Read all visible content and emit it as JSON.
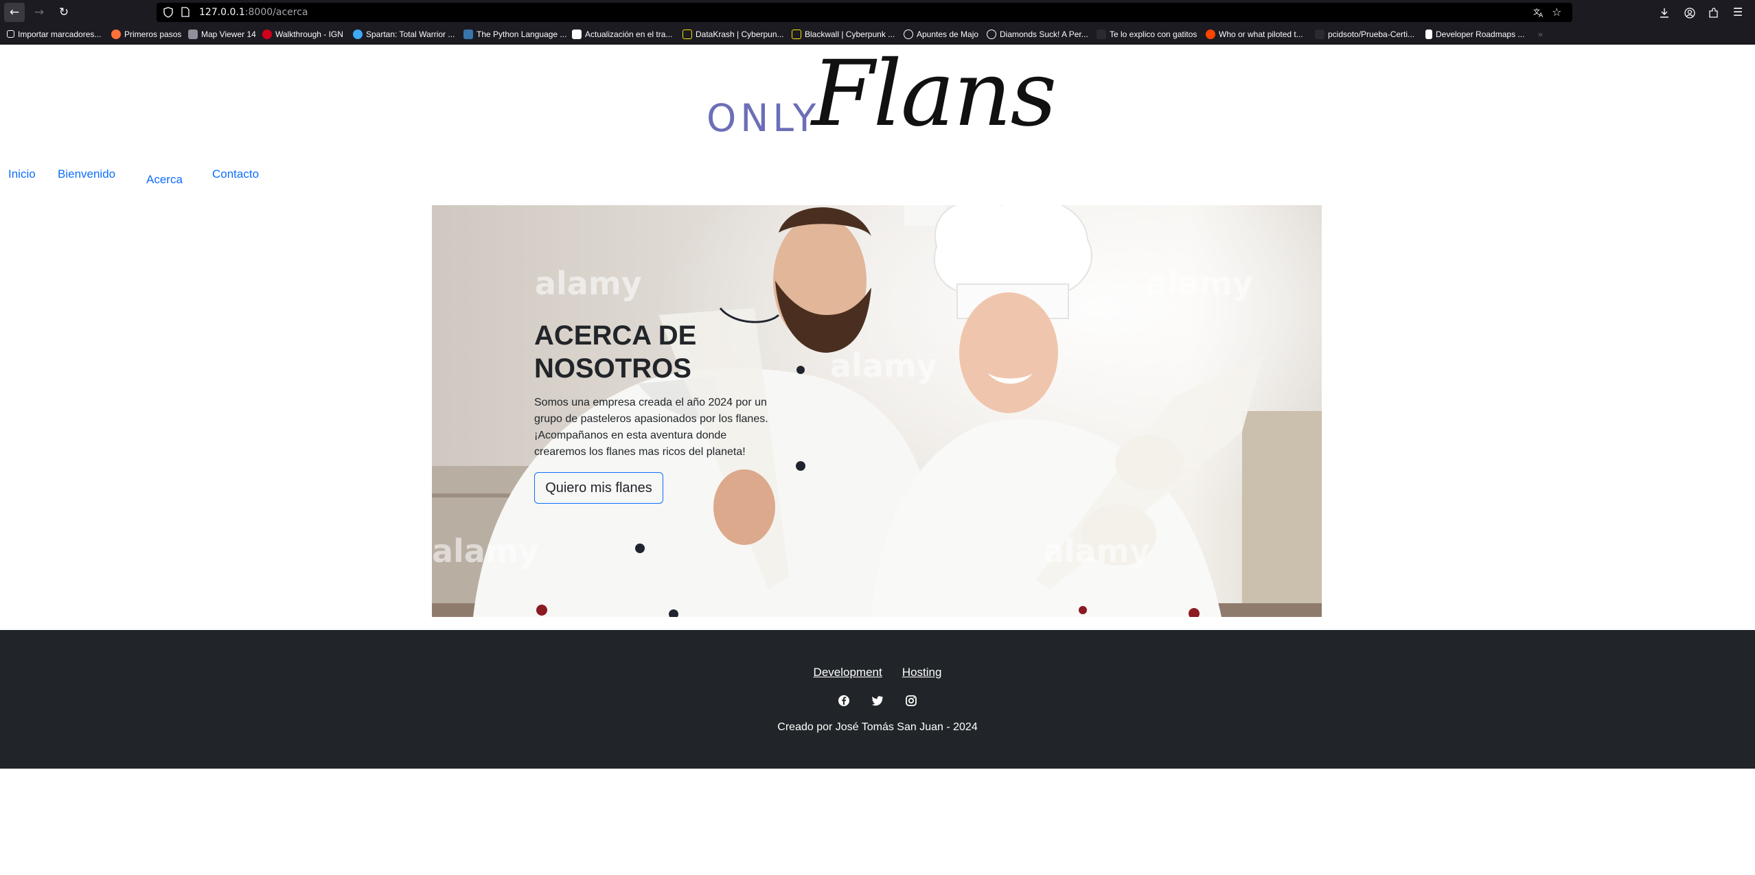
{
  "browser": {
    "url_host": "127.0.0.1",
    "url_path": ":8000/acerca",
    "bookmarks": [
      {
        "label": "Importar marcadores...",
        "color": "#ffffff"
      },
      {
        "label": "Primeros pasos",
        "color": "#ff7139"
      },
      {
        "label": "Map Viewer 14",
        "color": "#8f8f9d"
      },
      {
        "label": "Walkthrough - IGN",
        "color": "#d0021b"
      },
      {
        "label": "Spartan: Total Warrior ...",
        "color": "#3fa9f5"
      },
      {
        "label": "The Python Language ...",
        "color": "#3776ab"
      },
      {
        "label": "Actualización en el tra...",
        "color": "#ffffff"
      },
      {
        "label": "DataKrash | Cyberpun...",
        "color": "#f3e600"
      },
      {
        "label": "Blackwall | Cyberpunk ...",
        "color": "#f3e600"
      },
      {
        "label": "Apuntes de Majo",
        "color": "#8f8f9d"
      },
      {
        "label": "Diamonds Suck! A Per...",
        "color": "#8f8f9d"
      },
      {
        "label": "Te lo explico con gatitos",
        "color": "#2b2a33"
      },
      {
        "label": "Who or what piloted t...",
        "color": "#ff4500"
      },
      {
        "label": "pcidsoto/Prueba-Certi...",
        "color": "#2b2a33"
      },
      {
        "label": "Developer Roadmaps ...",
        "color": "#ffffff"
      }
    ]
  },
  "site": {
    "logo_only": "ONLY",
    "logo_flans": "Flans",
    "nav": [
      "Inicio",
      "Bienvenido",
      "Acerca",
      "Contacto"
    ],
    "hero": {
      "heading": "ACERCA DE NOSOTROS",
      "text": "Somos una empresa creada el año 2024 por un grupo de pasteleros apasionados por los flanes. ¡Acompañanos en esta aventura donde crearemos los flanes mas ricos del planeta!",
      "button": "Quiero mis flanes",
      "watermark": "alamy"
    },
    "footer": {
      "links": [
        "Development",
        "Hosting"
      ],
      "social": [
        "facebook-icon",
        "twitter-icon",
        "instagram-icon"
      ],
      "credit": "Creado por José Tomás San Juan - 2024"
    },
    "colors": {
      "link": "#0d6efd",
      "logo_only": "#6c6eb8",
      "footer_bg": "#212529",
      "browser_bg": "#1c1b22"
    }
  }
}
